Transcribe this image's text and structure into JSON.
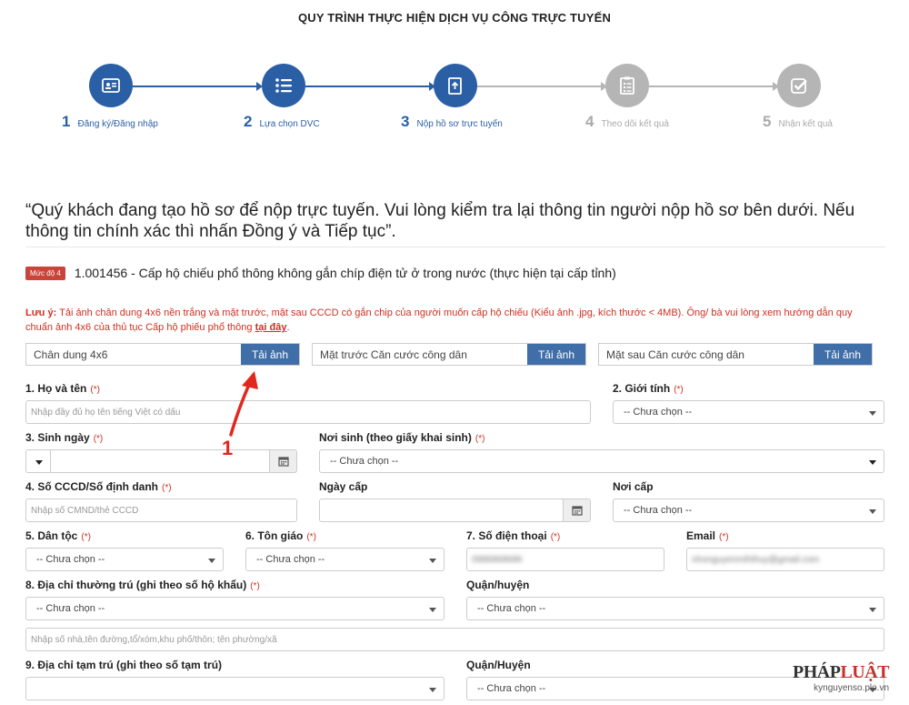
{
  "page_title": "QUY TRÌNH THỰC HIỆN DỊCH VỤ CÔNG TRỰC TUYẾN",
  "steps": [
    {
      "num": "1",
      "label": "Đăng ký/Đăng nhập",
      "icon": "id-card-icon",
      "active": true
    },
    {
      "num": "2",
      "label": "Lựa chọn DVC",
      "icon": "list-icon",
      "active": true
    },
    {
      "num": "3",
      "label": "Nộp hồ sơ trực tuyến",
      "icon": "document-upload-icon",
      "active": true
    },
    {
      "num": "4",
      "label": "Theo dõi kết quả",
      "icon": "checklist-icon",
      "active": false
    },
    {
      "num": "5",
      "label": "Nhận kết quả",
      "icon": "check-icon",
      "active": false
    }
  ],
  "colors": {
    "active": "#2a5fa6",
    "inactive": "#b5b5b5",
    "required": "#d0301f",
    "button": "#3f6ea8",
    "badge": "#c9443a"
  },
  "intro_text": "“Quý khách đang tạo hồ sơ để nộp trực tuyến. Vui lòng kiểm tra lại thông tin người nộp hồ sơ bên dưới. Nếu thông tin chính xác thì nhấn Đồng ý và Tiếp tục”.",
  "procedure": {
    "badge": "Mức độ 4",
    "title": "1.001456 - Cấp hộ chiếu phổ thông không gắn chíp điện tử ở trong nước (thực hiện tại cấp tỉnh)"
  },
  "note": {
    "prefix": "Lưu ý:",
    "text": " Tải ảnh chân dung 4x6 nền trắng và mặt trước, mặt sau CCCD có gắn chip của người muốn cấp hộ chiếu (Kiểu ảnh .jpg, kích thước < 4MB). Ông/ bà vui lòng xem hướng dẫn quy chuẩn ảnh 4x6 của thủ tục Cấp hộ phiếu phổ thông ",
    "link": "tại đây",
    "suffix": "."
  },
  "uploads": [
    {
      "label": "Chân dung 4x6",
      "button": "Tải ảnh"
    },
    {
      "label": "Mặt trước Căn cước công dân",
      "button": "Tải ảnh"
    },
    {
      "label": "Mặt sau Căn cước công dân",
      "button": "Tải ảnh"
    }
  ],
  "required_mark": "(*)",
  "form": {
    "ho_ten_label": "1. Họ và tên",
    "ho_ten_placeholder": "Nhập đầy đủ họ tên tiếng Việt có dấu",
    "gioi_tinh_label": "2. Giới tính",
    "gioi_tinh_value": "-- Chưa chọn --",
    "sinh_ngay_label": "3. Sinh ngày",
    "noi_sinh_label": "Nơi sinh (theo giấy khai sinh)",
    "noi_sinh_value": "-- Chưa chọn --",
    "cccd_label": "4. Số CCCD/Số định danh",
    "cccd_placeholder": "Nhập số CMND/thẻ CCCD",
    "ngay_cap_label": "Ngày cấp",
    "noi_cap_label": "Nơi cấp",
    "noi_cap_value": "-- Chưa chọn --",
    "dan_toc_label": "5. Dân tộc",
    "dan_toc_value": "-- Chưa chọn --",
    "ton_giao_label": "6. Tôn giáo",
    "ton_giao_value": "-- Chưa chọn --",
    "sdt_label": "7. Số điện thoại",
    "sdt_value": "0986868686",
    "email_label": "Email",
    "email_value": "nhonguyenmihthuy@gmail.com",
    "thuong_tru_label": "8. Địa chỉ thường trú (ghi theo số hộ khẩu)",
    "thuong_tru_value": "-- Chưa chọn --",
    "quan_huyen_label": "Quận/huyện",
    "quan_huyen_value": "-- Chưa chọn --",
    "dia_chi_placeholder": "Nhập số nhà,tên đường,tổ/xóm,khu phố/thôn; tên phường/xã",
    "tam_tru_label": "9. Địa chỉ tạm trú (ghi theo số tạm trú)",
    "quan_huyen2_label": "Quận/Huyện",
    "quan_huyen2_value": "-- Chưa chọn --"
  },
  "annotation_number": "1",
  "watermark": {
    "brand_a": "PHÁP",
    "brand_b": "LUẬT",
    "site": "kynguyenso.plo.vn"
  }
}
